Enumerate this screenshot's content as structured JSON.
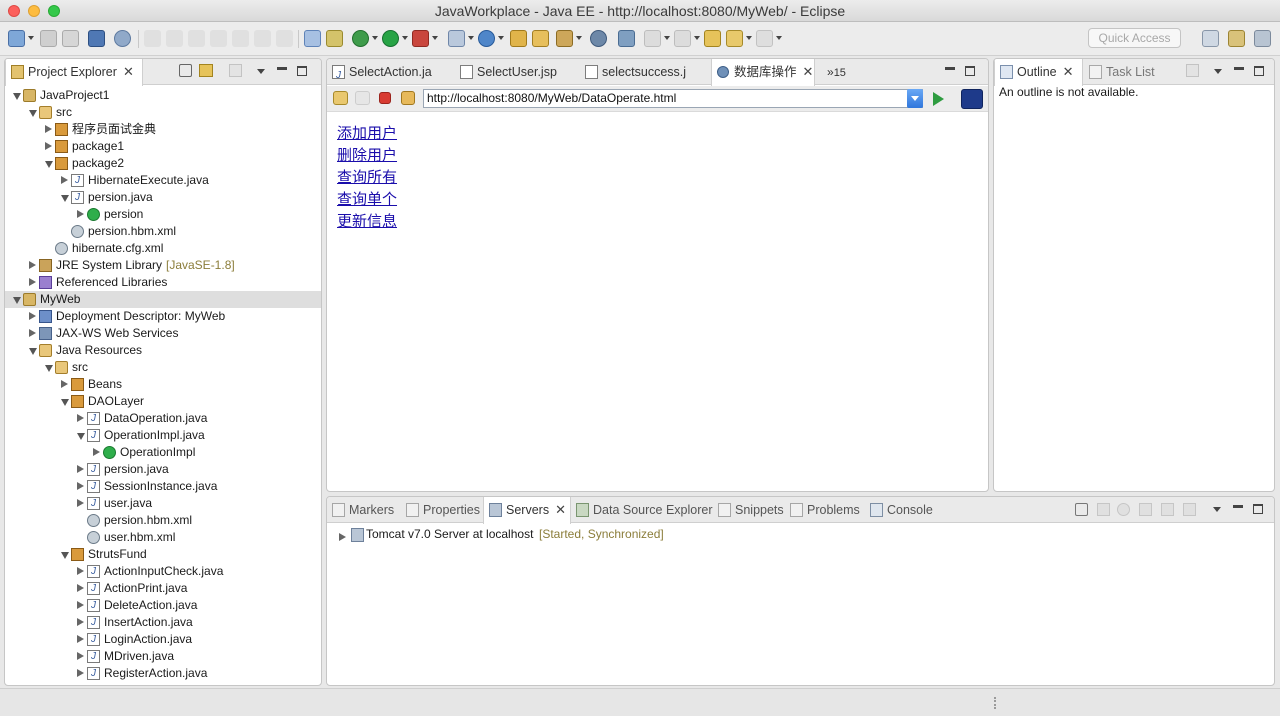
{
  "window": {
    "title": "JavaWorkplace - Java EE - http://localhost:8080/MyWeb/ - Eclipse"
  },
  "toolbar": {
    "quick_access_placeholder": "Quick Access"
  },
  "project_explorer": {
    "tab_label": "Project Explorer",
    "items": [
      {
        "label": "JavaProject1",
        "level": 0,
        "twisty": "open",
        "icon": "project"
      },
      {
        "label": "src",
        "level": 1,
        "twisty": "open",
        "icon": "srcfolder"
      },
      {
        "label": "程序员面试金典",
        "level": 2,
        "twisty": "closed",
        "icon": "pkg"
      },
      {
        "label": "package1",
        "level": 2,
        "twisty": "closed",
        "icon": "pkg"
      },
      {
        "label": "package2",
        "level": 2,
        "twisty": "open",
        "icon": "pkg"
      },
      {
        "label": "HibernateExecute.java",
        "level": 3,
        "twisty": "closed",
        "icon": "java"
      },
      {
        "label": "persion.java",
        "level": 3,
        "twisty": "open",
        "icon": "java"
      },
      {
        "label": "persion",
        "level": 4,
        "twisty": "closed",
        "icon": "class"
      },
      {
        "label": "persion.hbm.xml",
        "level": 3,
        "twisty": "none",
        "icon": "xml"
      },
      {
        "label": "hibernate.cfg.xml",
        "level": 2,
        "twisty": "none",
        "icon": "xml"
      },
      {
        "label": "JRE System Library",
        "decoration": "[JavaSE-1.8]",
        "level": 1,
        "twisty": "closed",
        "icon": "jr"
      },
      {
        "label": "Referenced Libraries",
        "level": 1,
        "twisty": "closed",
        "icon": "lib"
      },
      {
        "label": "MyWeb",
        "level": 0,
        "twisty": "open",
        "icon": "project",
        "selected": true
      },
      {
        "label": "Deployment Descriptor: MyWeb",
        "level": 1,
        "twisty": "closed",
        "icon": "dd"
      },
      {
        "label": "JAX-WS Web Services",
        "level": 1,
        "twisty": "closed",
        "icon": "ws"
      },
      {
        "label": "Java Resources",
        "level": 1,
        "twisty": "open",
        "icon": "srcfolder"
      },
      {
        "label": "src",
        "level": 2,
        "twisty": "open",
        "icon": "srcfolder"
      },
      {
        "label": "Beans",
        "level": 3,
        "twisty": "closed",
        "icon": "pkg"
      },
      {
        "label": "DAOLayer",
        "level": 3,
        "twisty": "open",
        "icon": "pkg"
      },
      {
        "label": "DataOperation.java",
        "level": 4,
        "twisty": "closed",
        "icon": "java"
      },
      {
        "label": "OperationImpl.java",
        "level": 4,
        "twisty": "open",
        "icon": "java"
      },
      {
        "label": "OperationImpl",
        "level": 5,
        "twisty": "closed",
        "icon": "class"
      },
      {
        "label": "persion.java",
        "level": 4,
        "twisty": "closed",
        "icon": "java"
      },
      {
        "label": "SessionInstance.java",
        "level": 4,
        "twisty": "closed",
        "icon": "java"
      },
      {
        "label": "user.java",
        "level": 4,
        "twisty": "closed",
        "icon": "java"
      },
      {
        "label": "persion.hbm.xml",
        "level": 4,
        "twisty": "none",
        "icon": "xml"
      },
      {
        "label": "user.hbm.xml",
        "level": 4,
        "twisty": "none",
        "icon": "xml"
      },
      {
        "label": "StrutsFund",
        "level": 3,
        "twisty": "open",
        "icon": "pkg"
      },
      {
        "label": "ActionInputCheck.java",
        "level": 4,
        "twisty": "closed",
        "icon": "java"
      },
      {
        "label": "ActionPrint.java",
        "level": 4,
        "twisty": "closed",
        "icon": "java"
      },
      {
        "label": "DeleteAction.java",
        "level": 4,
        "twisty": "closed",
        "icon": "java"
      },
      {
        "label": "InsertAction.java",
        "level": 4,
        "twisty": "closed",
        "icon": "java"
      },
      {
        "label": "LoginAction.java",
        "level": 4,
        "twisty": "closed",
        "icon": "java"
      },
      {
        "label": "MDriven.java",
        "level": 4,
        "twisty": "closed",
        "icon": "java"
      },
      {
        "label": "RegisterAction.java",
        "level": 4,
        "twisty": "closed",
        "icon": "java"
      }
    ]
  },
  "editor": {
    "tabs": [
      {
        "label": "SelectAction.ja",
        "icon": "java"
      },
      {
        "label": "SelectUser.jsp",
        "icon": "jsp"
      },
      {
        "label": "selectsuccess.j",
        "icon": "jsp"
      },
      {
        "label": "数据库操作",
        "icon": "globe",
        "active": true
      }
    ],
    "overflow_count": "15",
    "url": "http://localhost:8080/MyWeb/DataOperate.html",
    "links": [
      "添加用户",
      "删除用户",
      "查询所有",
      "查询单个",
      "更新信息"
    ]
  },
  "outline": {
    "tabs": [
      {
        "label": "Outline",
        "active": true
      },
      {
        "label": "Task List"
      }
    ],
    "message": "An outline is not available."
  },
  "bottom": {
    "tabs": [
      {
        "label": "Markers"
      },
      {
        "label": "Properties"
      },
      {
        "label": "Servers",
        "active": true
      },
      {
        "label": "Data Source Explorer"
      },
      {
        "label": "Snippets"
      },
      {
        "label": "Problems"
      },
      {
        "label": "Console"
      }
    ],
    "server": {
      "name": "Tomcat v7.0 Server at localhost",
      "state": "[Started, Synchronized]"
    }
  },
  "colors": {
    "link": "#1a0dab",
    "selection": "#dedede",
    "decoration": "#8b7d3a"
  }
}
